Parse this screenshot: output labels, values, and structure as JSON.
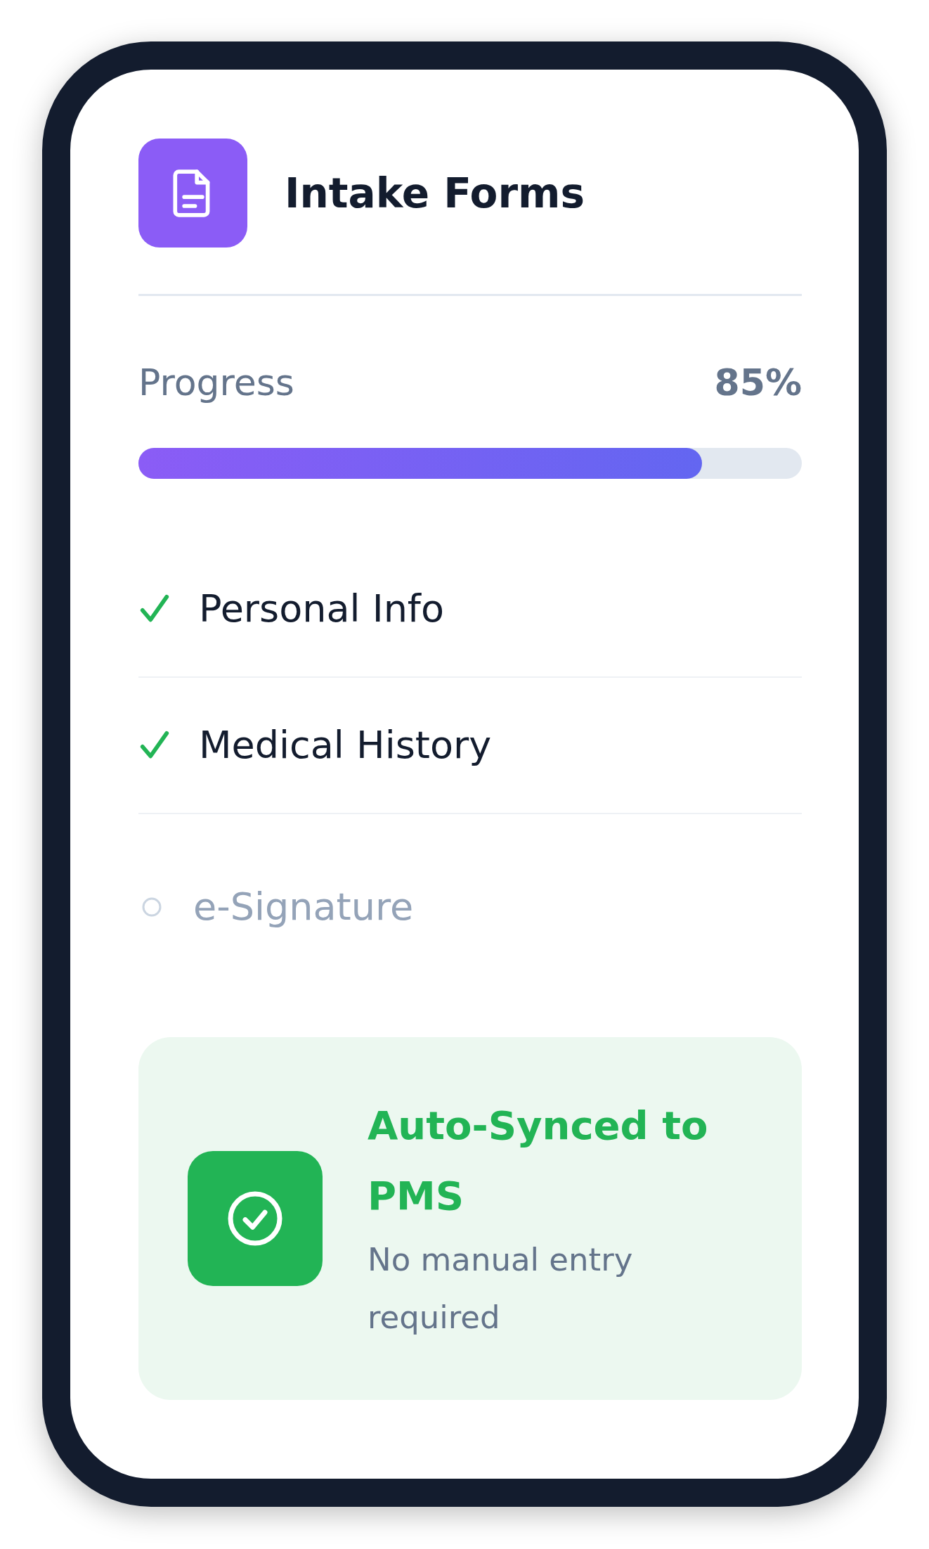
{
  "title": "Intake Forms",
  "progress": {
    "label": "Progress",
    "value": "85%",
    "level": 0.85
  },
  "steps": [
    {
      "label": "Personal Info",
      "done": true
    },
    {
      "label": "Medical History",
      "done": true
    },
    {
      "label": "e-Signature",
      "done": false
    }
  ],
  "sync_card": {
    "title": "Auto-Synced to PMS",
    "subtitle": "No manual entry required"
  }
}
